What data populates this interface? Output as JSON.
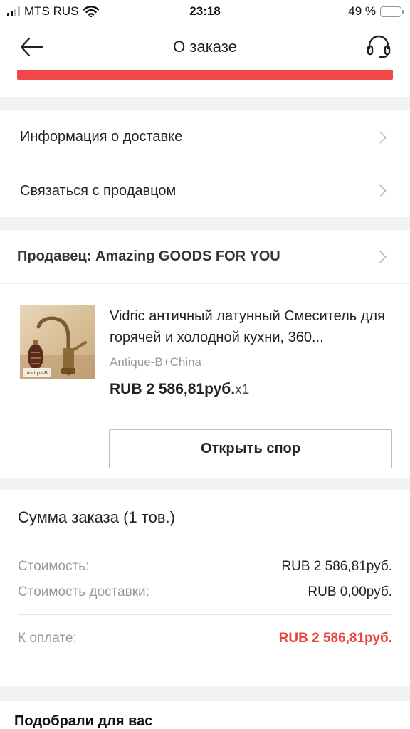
{
  "status_bar": {
    "carrier": "MTS RUS",
    "time": "23:18",
    "battery_percent": "49 %",
    "battery_level": 0.49,
    "battery_color": "#f5c518"
  },
  "header": {
    "back_icon": "arrow-left-icon",
    "title": "О заказе",
    "support_icon": "headset-icon",
    "progress_color": "#f44848",
    "progress_fraction": 1.0
  },
  "menu": {
    "items": [
      {
        "label": "Информация о доставке"
      },
      {
        "label": "Связаться с продавцом"
      }
    ]
  },
  "seller": {
    "label": "Продавец: Amazing GOODS FOR YOU"
  },
  "product": {
    "title": "Vidric античный латунный Смеситель для горячей и холодной кухни, 360...",
    "variant": "Antique-B+China",
    "price": "RUB 2 586,81руб.",
    "quantity": "x1",
    "image_label": "Antique-B",
    "dispute_button": "Открыть спор"
  },
  "summary": {
    "title": "Сумма заказа (1 тов.)",
    "cost_label": "Стоимость:",
    "cost_value": "RUB 2 586,81руб.",
    "shipping_label": "Стоимость доставки:",
    "shipping_value": "RUB 0,00руб.",
    "total_label": "К оплате:",
    "total_value": "RUB 2 586,81руб.",
    "total_color": "#e8473b"
  },
  "recommendations": {
    "title": "Подобрали для вас"
  }
}
